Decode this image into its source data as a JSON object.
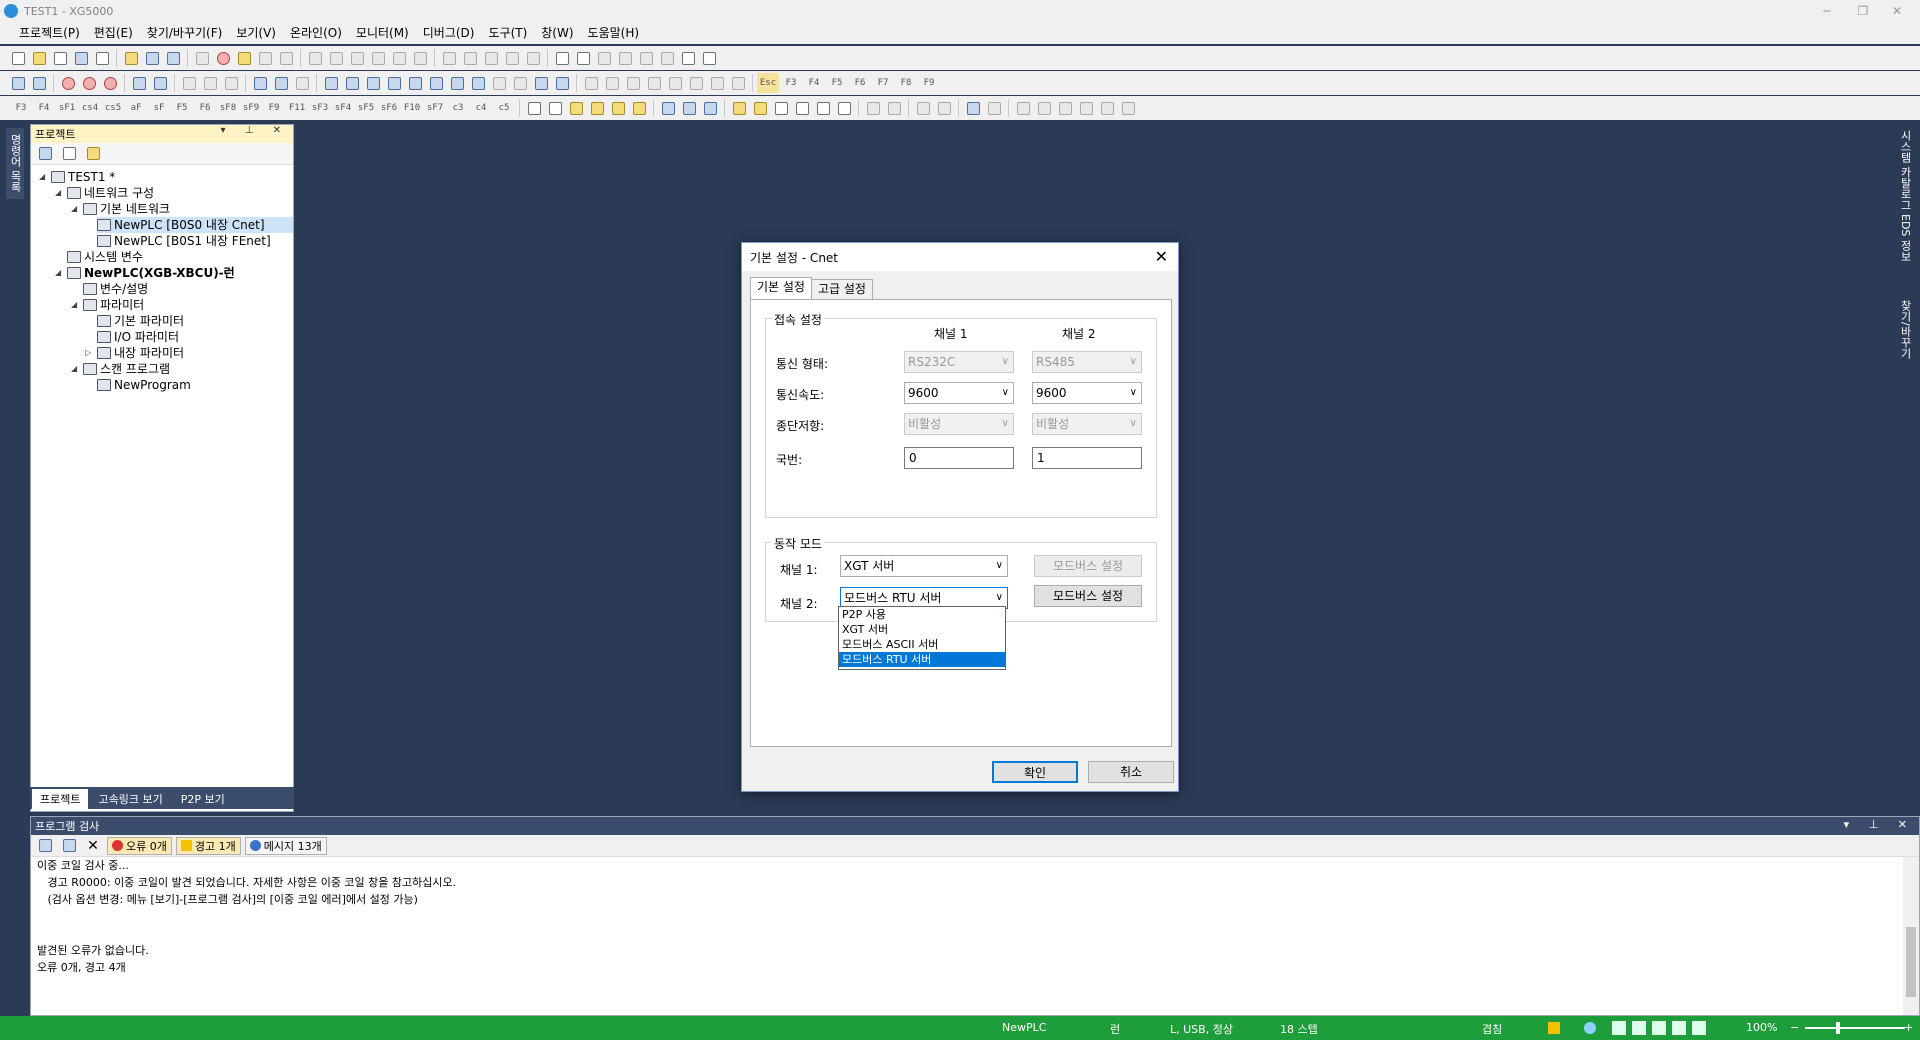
{
  "window": {
    "title": "TEST1 - XG5000",
    "minimize": "─",
    "restore": "❐",
    "close": "✕"
  },
  "menu": [
    "프로젝트(P)",
    "편집(E)",
    "찾기/바꾸기(F)",
    "보기(V)",
    "온라인(O)",
    "모니터(M)",
    "디버그(D)",
    "도구(T)",
    "창(W)",
    "도움말(H)"
  ],
  "toolbar_row3_keys": [
    "F3",
    "F4",
    "sF1",
    "cs4",
    "cs5",
    "aF",
    "sF",
    "F5",
    "F6",
    "sF8",
    "sF9",
    "F9",
    "F11",
    "sF3",
    "sF4",
    "sF5",
    "sF6",
    "F10",
    "sF7",
    "c3",
    "c4",
    "c5"
  ],
  "toolbar_row2_keys": [
    "Esc",
    "F3",
    "F4",
    "F5",
    "F6",
    "F7",
    "F8",
    "F9"
  ],
  "left_strip": {
    "label": "명령어 목록"
  },
  "project_panel": {
    "title": "프로젝트",
    "tree": [
      {
        "label": "TEST1 *"
      },
      {
        "label": "네트워크 구성"
      },
      {
        "label": "기본 네트워크"
      },
      {
        "label": "NewPLC [B0S0 내장 Cnet]"
      },
      {
        "label": "NewPLC [B0S1 내장 FEnet]"
      },
      {
        "label": "시스템 변수"
      },
      {
        "label": "NewPLC(XGB-XBCU)-런"
      },
      {
        "label": "변수/설명"
      },
      {
        "label": "파라미터"
      },
      {
        "label": "기본 파라미터"
      },
      {
        "label": "I/O 파라미터"
      },
      {
        "label": "내장 파라미터"
      },
      {
        "label": "스캔 프로그램"
      },
      {
        "label": "NewProgram"
      }
    ],
    "tabs": [
      "프로젝트",
      "고속링크 보기",
      "P2P 보기"
    ]
  },
  "right_strip": {
    "labels": [
      "시스템 카탈로그 EDS 정보",
      "찾기/바꾸기"
    ]
  },
  "output_panel": {
    "title": "프로그램 검사",
    "error_button": "오류 0개",
    "warning_button": "경고 1개",
    "message_button": "메시지 13개",
    "lines": [
      "이중 코일 검사 중...",
      "   경고 R0000: 이중 코일이 발견 되었습니다. 자세한 사항은 이중 코일 창을 참고하십시오.",
      "   (검사 옵션 변경: 메뉴 [보기]-[프로그램 검사]의 [이중 코일 에러]에서 설정 가능)",
      "",
      "",
      "발견된 오류가 없습니다.",
      "오류 0개, 경고 4개"
    ]
  },
  "status": {
    "plc": "NewPLC",
    "mode": "런",
    "connection": "L, USB, 정상",
    "steps": "18 스텝",
    "overwrite": "겹침",
    "zoom": "100%"
  },
  "dialog": {
    "title": "기본 설정 - Cnet",
    "close": "✕",
    "tabs": [
      "기본 설정",
      "고급 설정"
    ],
    "conn_group": "접속 설정",
    "ch1_header": "채널 1",
    "ch2_header": "채널 2",
    "rows": {
      "comm_type": {
        "label": "통신 형태:",
        "ch1": "RS232C",
        "ch2": "RS485"
      },
      "speed": {
        "label": "통신속도:",
        "ch1": "9600",
        "ch2": "9600"
      },
      "termination": {
        "label": "종단저항:",
        "ch1": "비활성",
        "ch2": "비활성"
      },
      "station": {
        "label": "국번:",
        "ch1": "0",
        "ch2": "1"
      }
    },
    "mode_group": "동작 모드",
    "ch1_label": "채널 1:",
    "ch2_label": "채널 2:",
    "ch1_mode": "XGT 서버",
    "ch2_mode": "모드버스 RTU 서버",
    "modbus_btn1": "모드버스 설정",
    "modbus_btn2": "모드버스 설정",
    "dropdown_options": [
      "P2P 사용",
      "XGT 서버",
      "모드버스 ASCII 서버",
      "모드버스 RTU 서버"
    ],
    "ok": "확인",
    "cancel": "취소"
  }
}
